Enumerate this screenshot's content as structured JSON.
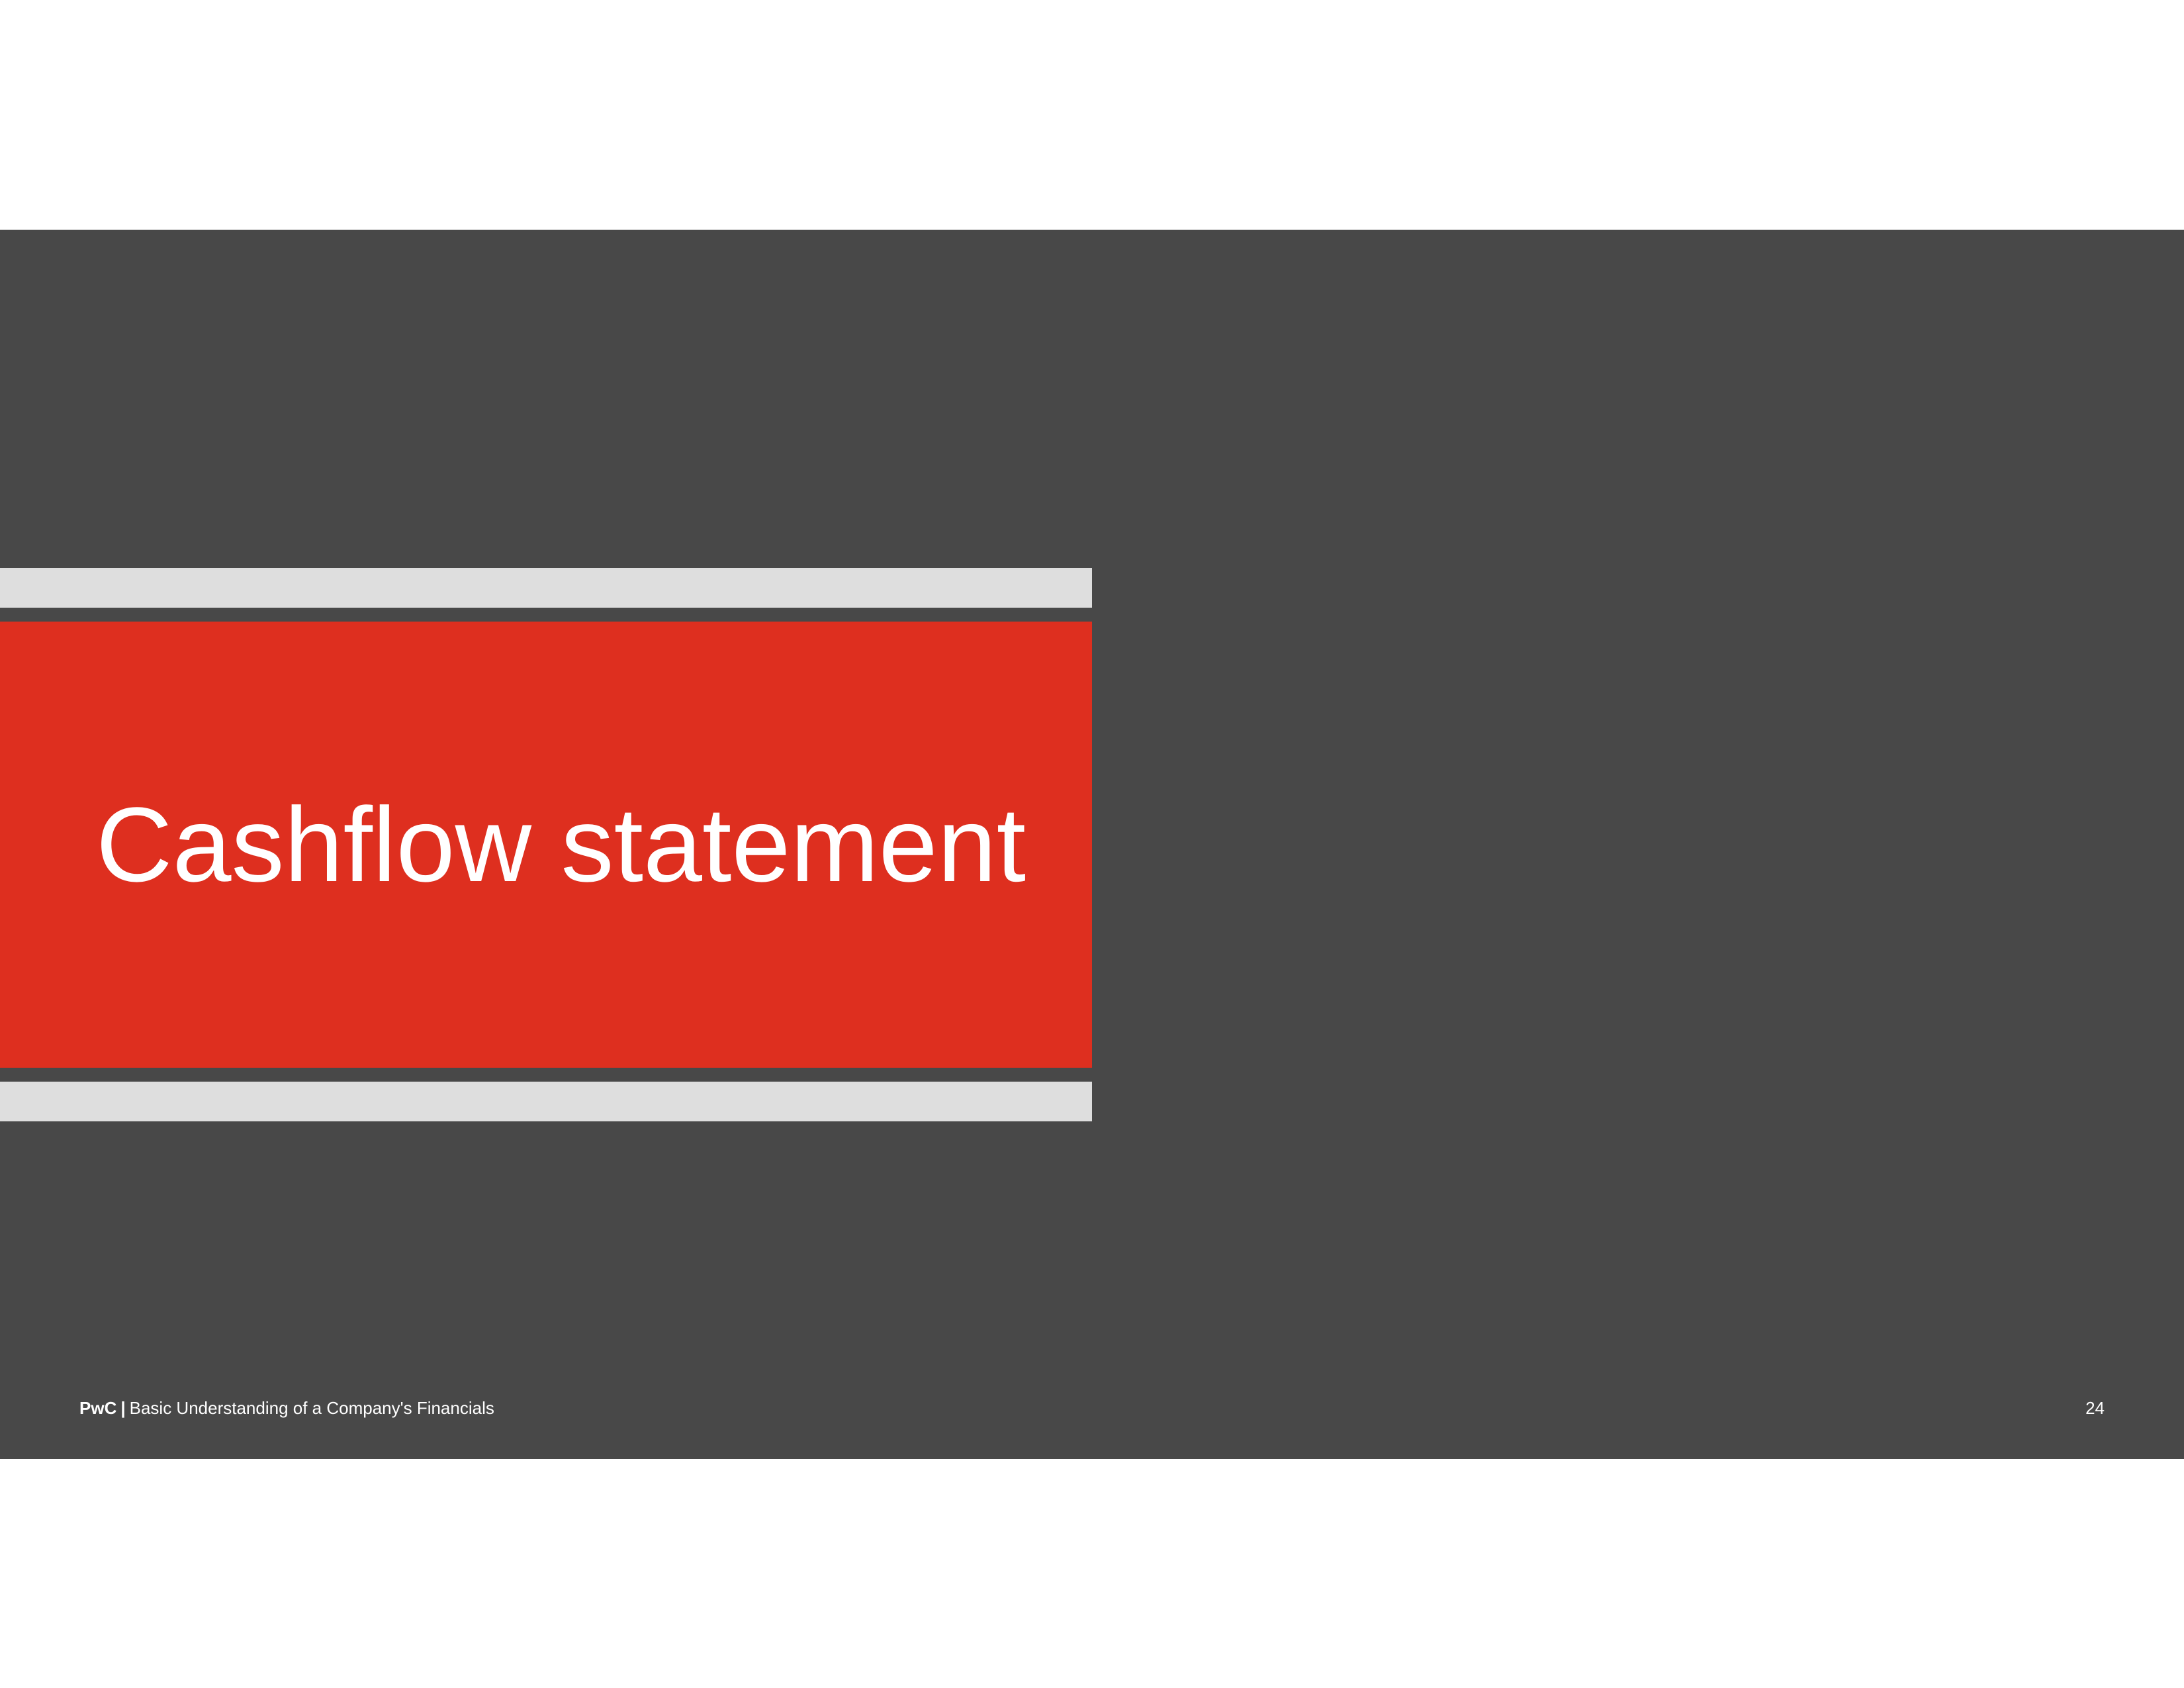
{
  "slide": {
    "title": "Cashflow statement",
    "footer": {
      "brand": "PwC",
      "separator": "|",
      "text": "Basic Understanding of a Company's Financials",
      "page_number": "24"
    }
  },
  "colors": {
    "background": "#484848",
    "accent_red": "#de2f1f",
    "band_gray": "#dedede",
    "text": "#ffffff"
  }
}
